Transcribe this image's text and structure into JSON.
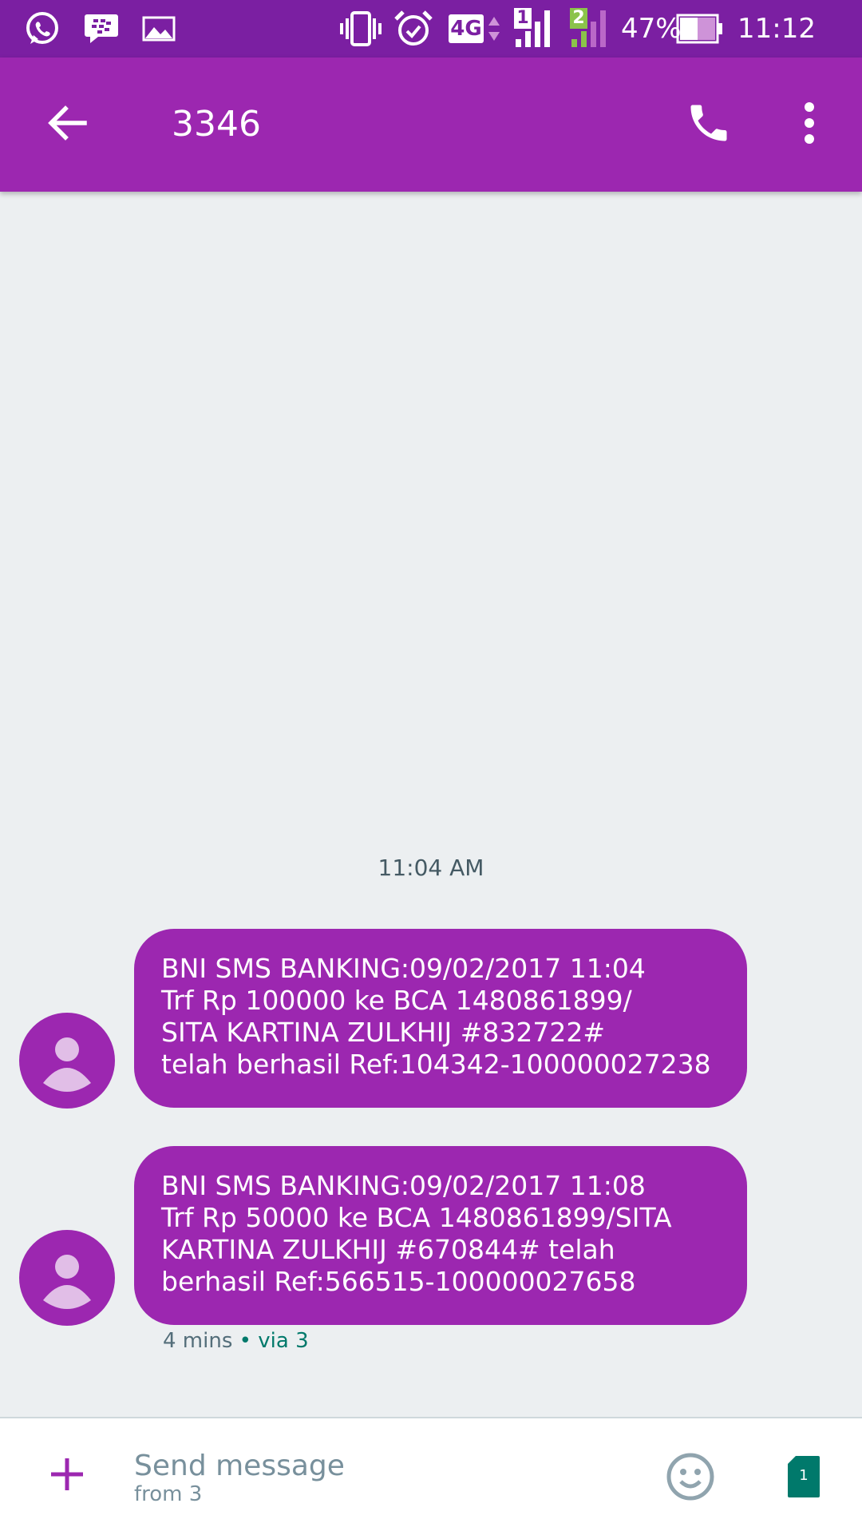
{
  "status_bar": {
    "network": "4G",
    "sim1_label": "1",
    "sim2_label": "2",
    "battery": "47%",
    "time": "11:12 AM"
  },
  "toolbar": {
    "title": "3346"
  },
  "conversation": {
    "timestamp": "11:04 AM",
    "messages": [
      {
        "text": "BNI SMS BANKING:09/02/2017 11:04\nTrf Rp 100000 ke BCA 1480861899/\nSITA KARTINA ZULKHIJ #832722#\ntelah berhasil Ref:104342-100000027238"
      },
      {
        "text": "BNI SMS BANKING:09/02/2017 11:08\nTrf Rp 50000 ke BCA 1480861899/SITA\nKARTINA ZULKHIJ #670844# telah\nberhasil Ref:566515-100000027658"
      }
    ],
    "meta_age": "4 mins",
    "meta_sep": "•",
    "meta_via": "via 3"
  },
  "compose": {
    "placeholder": "Send message",
    "from": "from 3",
    "sim_badge": "1"
  },
  "colors": {
    "status_bar": "#7b1fa2",
    "app_bar": "#9c27b0",
    "bubble": "#9c27b0",
    "background": "#eceff1",
    "via_accent": "#00796b",
    "sim_badge": "#00796b"
  },
  "icons": [
    "whatsapp-icon",
    "bbm-icon",
    "gallery-icon",
    "vibrate-icon",
    "alarm-icon",
    "back-arrow-icon",
    "phone-icon",
    "more-vert-icon",
    "person-icon",
    "plus-icon",
    "emoji-icon",
    "sim-card-icon"
  ]
}
